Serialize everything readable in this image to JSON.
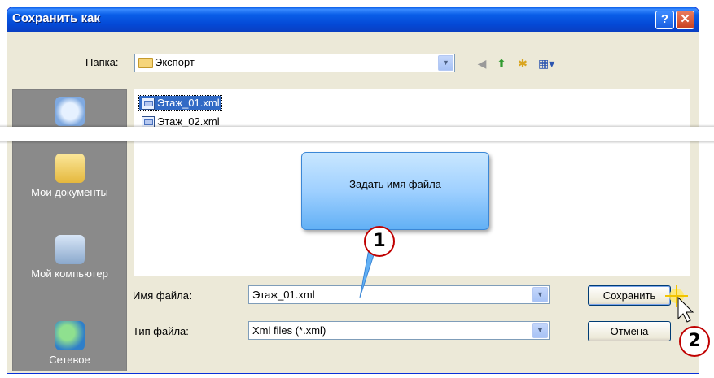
{
  "window": {
    "title": "Сохранить как",
    "help_glyph": "?",
    "close_glyph": "✕"
  },
  "folder": {
    "label": "Папка:",
    "value": "Экспорт"
  },
  "files": [
    {
      "name": "Этаж_01.xml",
      "selected": true
    },
    {
      "name": "Этаж_02.xml",
      "selected": false
    }
  ],
  "places": [
    {
      "label": "Мои документы",
      "icon": "my-documents-icon"
    },
    {
      "label": "Мой компьютер",
      "icon": "my-computer-icon"
    },
    {
      "label": "Сетевое",
      "icon": "network-icon"
    }
  ],
  "filename": {
    "label": "Имя файла:",
    "value": "Этаж_01.xml"
  },
  "filetype": {
    "label": "Тип файла:",
    "value": "Xml files (*.xml)"
  },
  "buttons": {
    "save": "Сохранить",
    "cancel": "Отмена"
  },
  "callout": {
    "text": "Задать имя файла"
  },
  "steps": [
    "1",
    "2"
  ],
  "colors": {
    "titlebar": "#0a5ee8",
    "selection": "#316ac5",
    "badge_border": "#c00000",
    "callout": "#9fd0ff"
  }
}
